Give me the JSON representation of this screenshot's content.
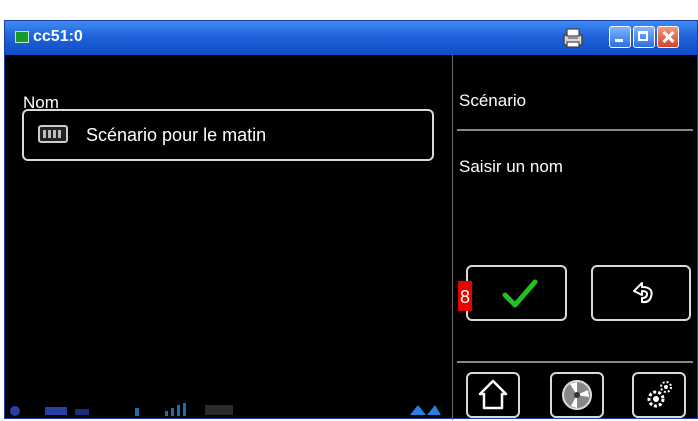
{
  "window": {
    "title": "cc51:0",
    "buttons": {
      "minimize": "minimize",
      "maximize": "maximize",
      "close": "close"
    }
  },
  "left": {
    "label": "Nom",
    "field": {
      "value": "Scénario pour le matin"
    }
  },
  "right": {
    "title": "Scénario",
    "prompt": "Saisir un nom",
    "badge": "8"
  },
  "colors": {
    "titlebar": "#1f63dc",
    "checkmark": "#22c11f",
    "badge": "#e60000",
    "border": "#d9d9d9"
  },
  "icons": [
    "keyboard-icon",
    "checkmark-icon",
    "back-arrow-icon",
    "home-icon",
    "fan-icon",
    "settings-gears-icon",
    "printer-icon"
  ]
}
